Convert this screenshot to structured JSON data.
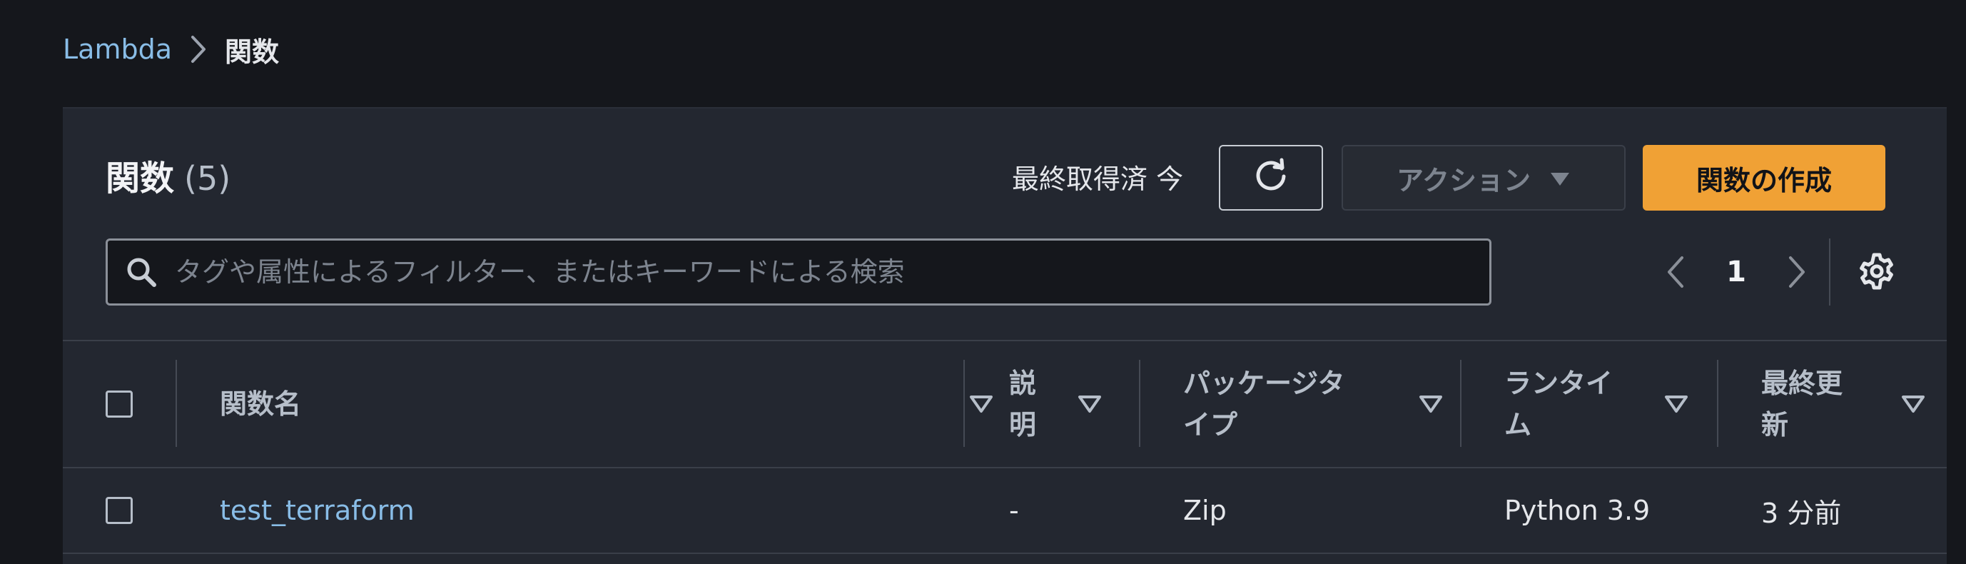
{
  "breadcrumb": {
    "root": "Lambda",
    "current": "関数"
  },
  "header": {
    "title": "関数",
    "count": "(5)",
    "last_fetched": "最終取得済 今",
    "actions_label": "アクション",
    "create_label": "関数の作成"
  },
  "search": {
    "placeholder": "タグや属性によるフィルター、またはキーワードによる検索"
  },
  "pagination": {
    "current_page": "1"
  },
  "table": {
    "columns": {
      "name": "関数名",
      "description": "説\n明",
      "package_type": "パッケージタ\nイプ",
      "runtime": "ランタイ\nム",
      "last_modified": "最終更\n新"
    },
    "rows": [
      {
        "name": "test_terraform",
        "description": "-",
        "package_type": "Zip",
        "runtime": "Python 3.9",
        "last_modified": "3 分前"
      }
    ]
  },
  "colors": {
    "background": "#15171c",
    "panel": "#232730",
    "link": "#89bde7",
    "primary_button": "#f0a135"
  }
}
